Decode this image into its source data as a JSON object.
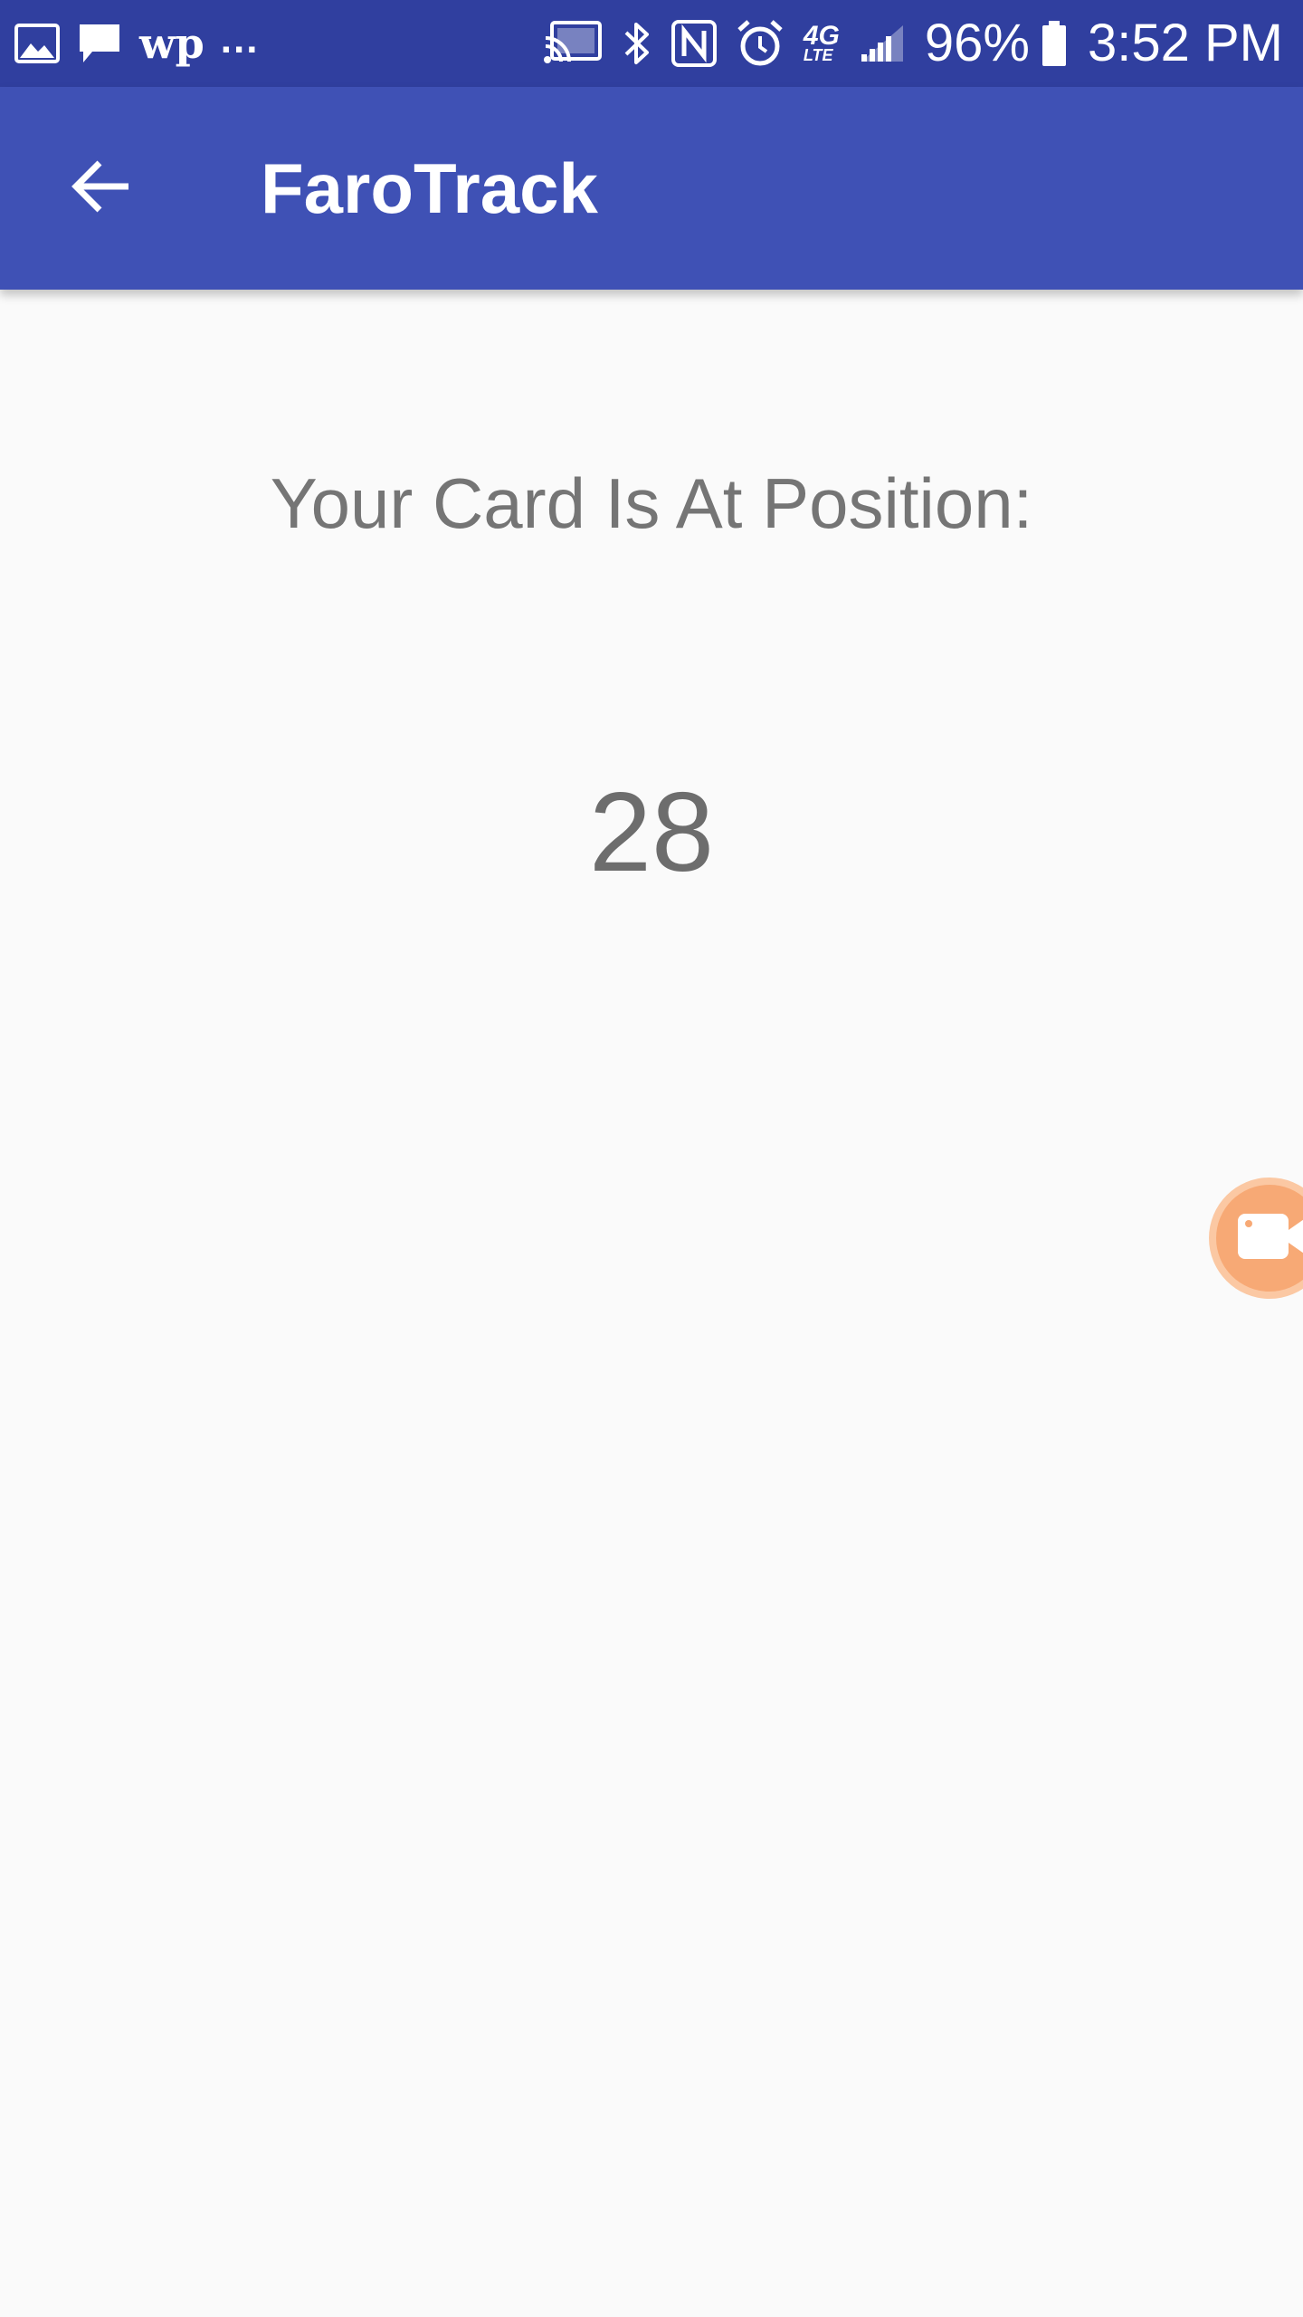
{
  "status_bar": {
    "left_icons": [
      "gallery-icon",
      "message-icon"
    ],
    "wp_logo": "wp",
    "overflow": "...",
    "right_icons": [
      "cast-icon",
      "bluetooth-icon",
      "nfc-icon",
      "alarm-icon"
    ],
    "network_top": "4G",
    "network_bottom": "LTE",
    "battery_percent": "96%",
    "time": "3:52 PM"
  },
  "app_bar": {
    "title": "FaroTrack",
    "back_icon": "arrow-back-icon"
  },
  "main": {
    "label": "Your Card Is At Position:",
    "position": "28"
  },
  "floating_button": {
    "icon": "video-camera-icon"
  },
  "colors": {
    "status_bar": "#303f9f",
    "app_bar": "#3f51b5",
    "background": "#fafafa",
    "text": "#757575",
    "bubble": "#f7a975"
  }
}
